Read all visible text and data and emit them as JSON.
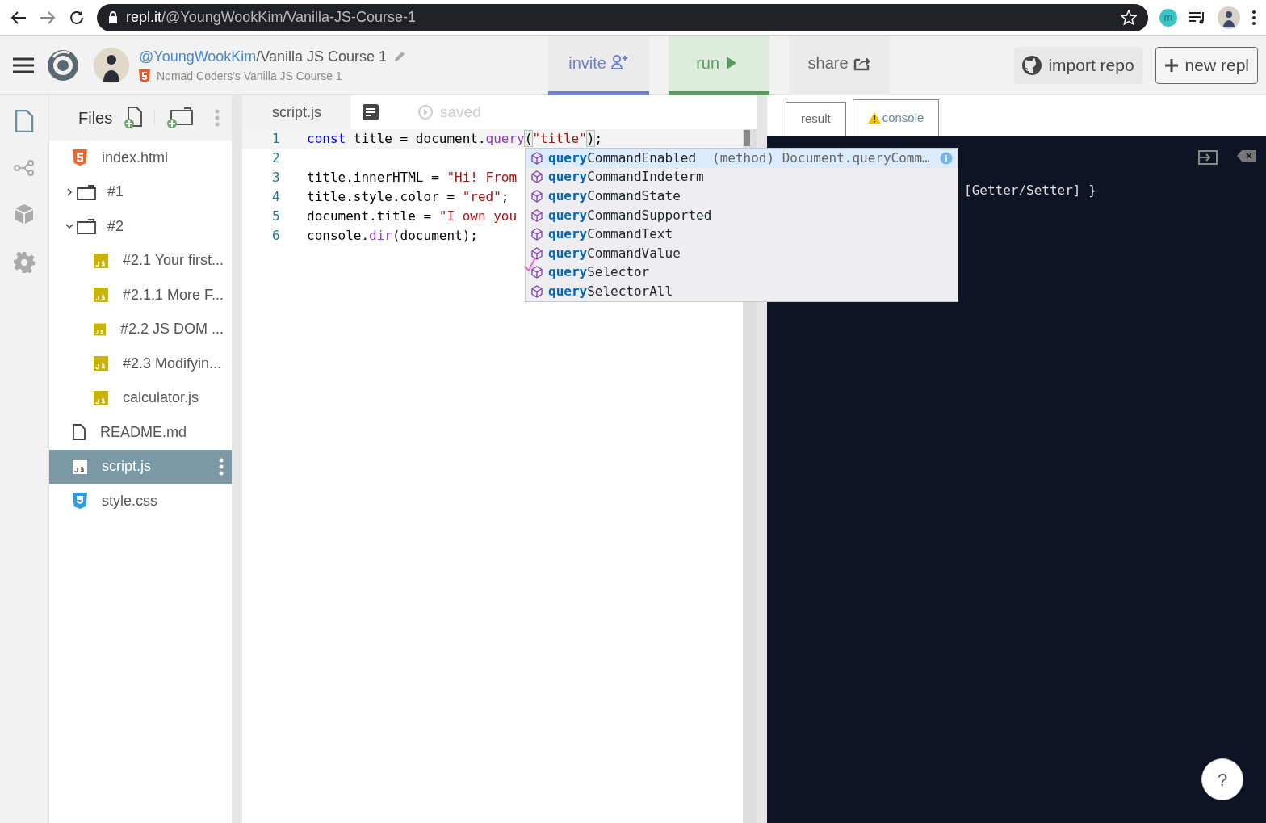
{
  "browser": {
    "url_host": "repl.it",
    "url_path": "/@YoungWookKim/Vanilla-JS-Course-1",
    "profile_initial": "m"
  },
  "header": {
    "owner": "@YoungWookKim",
    "repl_name": "/Vanilla JS Course 1",
    "subtitle": "Nomad Coders's Vanilla JS Course 1",
    "tabs": [
      {
        "label": "invite",
        "kind": "invite"
      },
      {
        "label": "run",
        "kind": "run"
      },
      {
        "label": "share",
        "kind": "share"
      }
    ],
    "buttons": [
      {
        "label": "import repo",
        "kind": "github"
      },
      {
        "label": "new repl",
        "kind": "new"
      }
    ]
  },
  "files": {
    "title": "Files",
    "tree": [
      {
        "name": "index.html",
        "kind": "html",
        "selected": false
      },
      {
        "name": "#1",
        "kind": "folder",
        "expanded": false,
        "selected": false
      },
      {
        "name": "#2",
        "kind": "folder",
        "expanded": true,
        "selected": false,
        "children": [
          {
            "name": "#2.1 Your first...",
            "kind": "js",
            "selected": false
          },
          {
            "name": "#2.1.1 More F...",
            "kind": "js",
            "selected": false
          },
          {
            "name": "#2.2 JS DOM ...",
            "kind": "js",
            "selected": false
          },
          {
            "name": "#2.3 Modifyin...",
            "kind": "js",
            "selected": false
          },
          {
            "name": "calculator.js",
            "kind": "js",
            "selected": false
          }
        ]
      },
      {
        "name": "README.md",
        "kind": "file",
        "selected": false
      },
      {
        "name": "script.js",
        "kind": "js",
        "selected": true
      },
      {
        "name": "style.css",
        "kind": "css",
        "selected": false
      }
    ]
  },
  "editor": {
    "tab": "script.js",
    "status": "saved",
    "lines": [
      {
        "number": "1",
        "tokens": [
          {
            "t": "const",
            "kind": "keyword"
          },
          {
            "t": " title = document.",
            "kind": "plain"
          },
          {
            "t": "query",
            "kind": "method"
          },
          {
            "t": "(",
            "kind": "bracket"
          },
          {
            "t": "\"title\"",
            "kind": "string"
          },
          {
            "t": ")",
            "kind": "bracket"
          },
          {
            "t": ";",
            "kind": "plain"
          }
        ]
      },
      {
        "number": "2"
      },
      {
        "number": "3",
        "tokens": [
          {
            "t": "title.innerHTML = ",
            "kind": "plain"
          },
          {
            "t": "\"Hi! From",
            "kind": "string"
          }
        ]
      },
      {
        "number": "4",
        "tokens": [
          {
            "t": "title.style.color = ",
            "kind": "plain"
          },
          {
            "t": "\"red\"",
            "kind": "string"
          },
          {
            "t": ";",
            "kind": "plain"
          }
        ]
      },
      {
        "number": "5",
        "tokens": [
          {
            "t": "document.title = ",
            "kind": "plain"
          },
          {
            "t": "\"I own you",
            "kind": "string"
          }
        ]
      },
      {
        "number": "6",
        "tokens": [
          {
            "t": "console.",
            "kind": "plain"
          },
          {
            "t": "dir",
            "kind": "method"
          },
          {
            "t": "(document);",
            "kind": "plain"
          }
        ]
      }
    ]
  },
  "autocomplete": {
    "items": [
      {
        "match": "query",
        "rest": "CommandEnabled",
        "detail": "(method) Document.queryComm…",
        "selected": true
      },
      {
        "match": "query",
        "rest": "CommandIndeterm",
        "selected": false
      },
      {
        "match": "query",
        "rest": "CommandState",
        "selected": false
      },
      {
        "match": "query",
        "rest": "CommandSupported",
        "selected": false
      },
      {
        "match": "query",
        "rest": "CommandText",
        "selected": false
      },
      {
        "match": "query",
        "rest": "CommandValue",
        "selected": false
      },
      {
        "match": "query",
        "rest": "Selector",
        "selected": false,
        "marked": true
      },
      {
        "match": "query",
        "rest": "SelectorAll",
        "selected": false
      }
    ]
  },
  "output": {
    "tabs": [
      {
        "label": "result",
        "selected": false,
        "warning": false
      },
      {
        "label": "console",
        "selected": true,
        "warning": true
      }
    ],
    "console_text": "[Getter/Setter] }"
  },
  "help": "?"
}
